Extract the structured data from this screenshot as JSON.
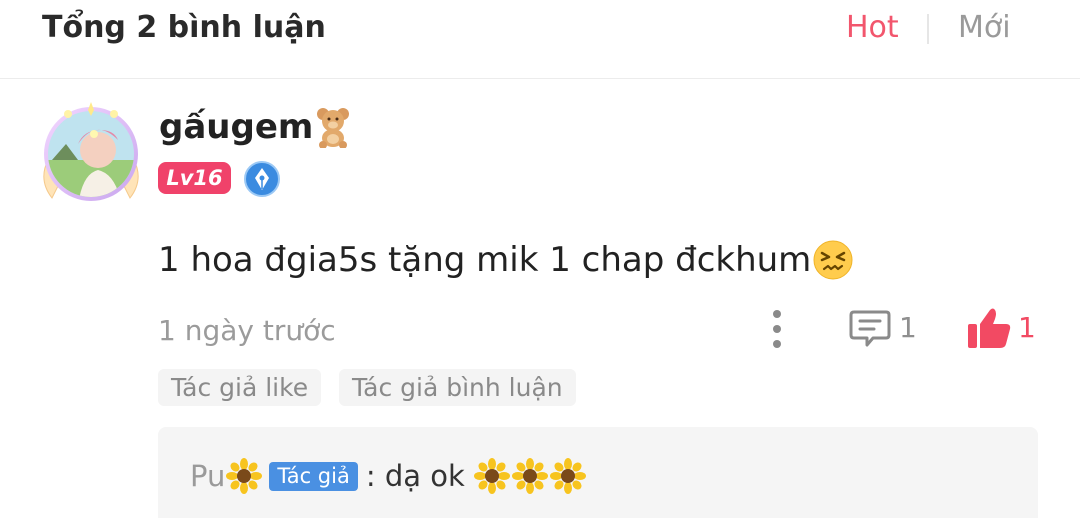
{
  "header": {
    "title": "Tổng 2 bình luận",
    "sort_hot": "Hot",
    "sort_new": "Mới"
  },
  "comment": {
    "username": "gấugem",
    "level": "Lv16",
    "text": "1 hoa đgia5s tặng mik 1 chap đckhum",
    "timestamp": "1 ngày trước",
    "reply_count": "1",
    "like_count": "1",
    "tags": [
      "Tác giả like",
      "Tác giả bình luận"
    ]
  },
  "reply": {
    "username": "Pu",
    "badge": "Tác giả",
    "text": ": dạ ok"
  },
  "colors": {
    "accent": "#f2566d",
    "level_badge": "#f0426a",
    "author_badge": "#4a90e2",
    "like": "#f24a63"
  }
}
